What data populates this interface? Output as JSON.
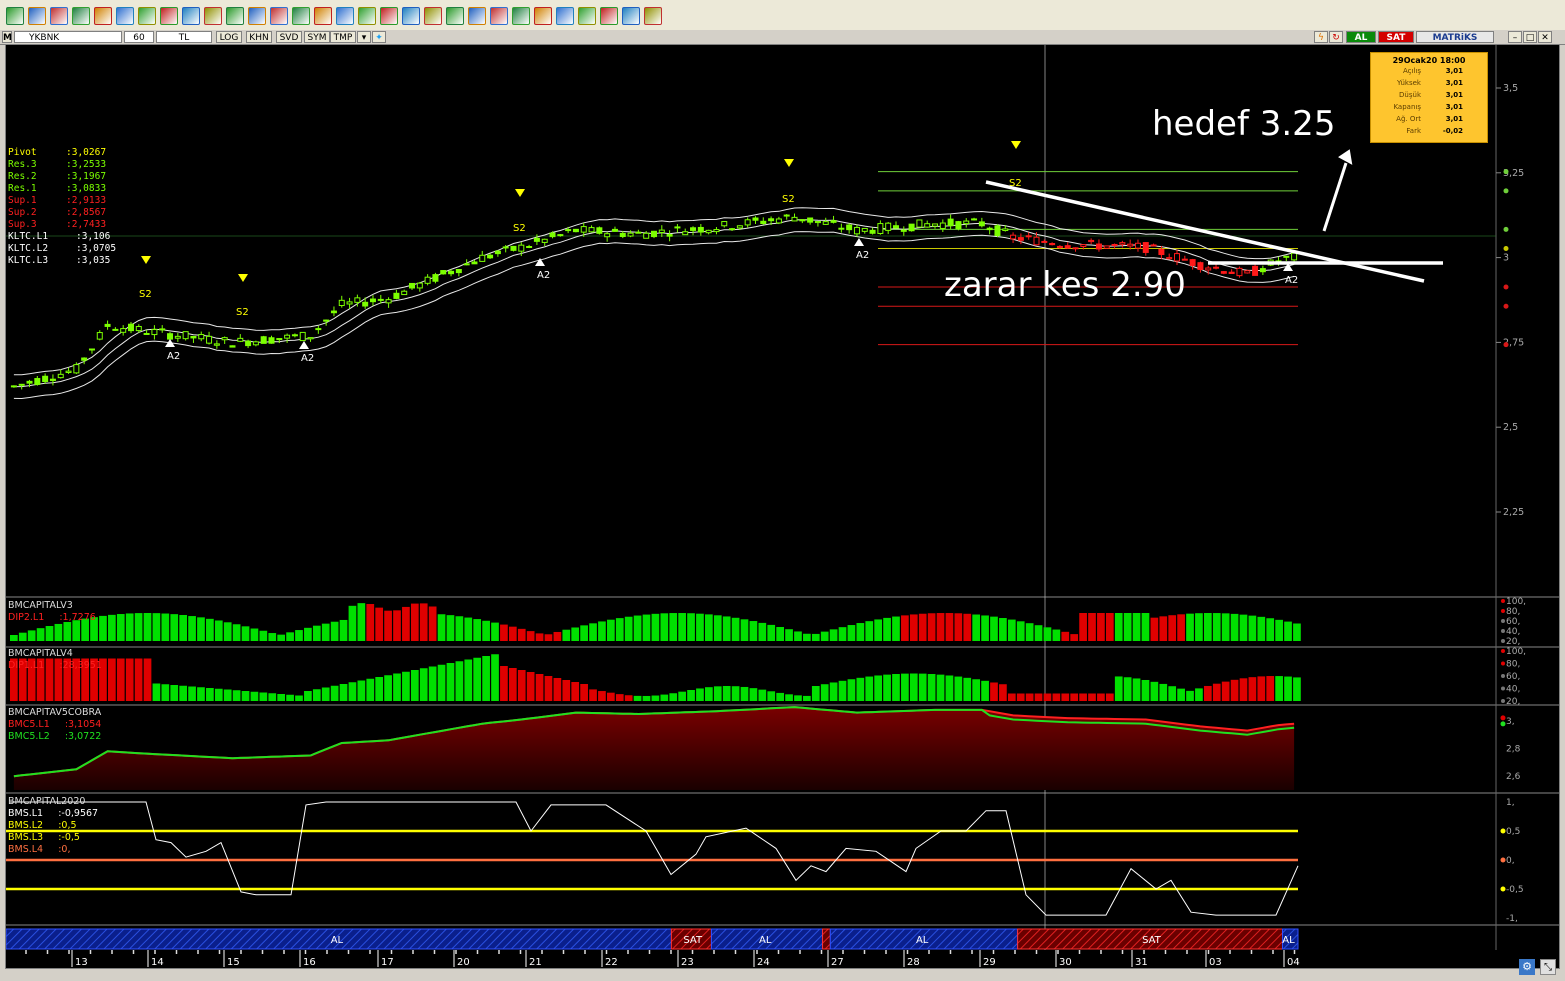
{
  "toolbar": {
    "icons": [
      "lock-icon",
      "cursor-icon",
      "zoom-icon",
      "edit-icon",
      "tools-icon",
      "pencil-icon",
      "eraser-icon",
      "hline-icon",
      "vline-icon",
      "trend-icon",
      "channel-icon",
      "fib-icon",
      "gann-icon",
      "arrow-icon",
      "text-icon",
      "ellipse-icon",
      "rect-icon",
      "cycle-icon",
      "speed-icon",
      "andrew-icon",
      "regression-icon",
      "price-icon",
      "bell-icon",
      "left-icon",
      "right-icon",
      "up-icon",
      "down-icon",
      "alarm-icon",
      "ruler-icon",
      "wave-icon"
    ]
  },
  "symbol_bar": {
    "logo": "M",
    "symbol": "YKBNK",
    "period": "60",
    "currency": "TL",
    "buttons": [
      "LOG",
      "KHN",
      "SVD",
      "SYM",
      "TMP"
    ],
    "al_label": "AL",
    "sat_label": "SAT",
    "brand": "MATRiKS"
  },
  "info_box": {
    "title": "29Ocak20 18:00",
    "rows": [
      {
        "k": "Açılış",
        "v": "3,01"
      },
      {
        "k": "Yüksek",
        "v": "3,01"
      },
      {
        "k": "Düşük",
        "v": "3,01"
      },
      {
        "k": "Kapanış",
        "v": "3,01"
      },
      {
        "k": "Ağ. Ort",
        "v": "3,01"
      },
      {
        "k": "Fark",
        "v": "-0,02"
      }
    ]
  },
  "pivot_legend": [
    {
      "k": "Pivot",
      "v": ":3,0267",
      "color": "#ffff00"
    },
    {
      "k": "Res.3",
      "v": ":3,2533",
      "color": "#7cff00"
    },
    {
      "k": "Res.2",
      "v": ":3,1967",
      "color": "#7cff00"
    },
    {
      "k": "Res.1",
      "v": ":3,0833",
      "color": "#7cff00"
    },
    {
      "k": "Sup.1",
      "v": ":2,9133",
      "color": "#ff2020"
    },
    {
      "k": "Sup.2",
      "v": ":2,8567",
      "color": "#ff2020"
    },
    {
      "k": "Sup.3",
      "v": ":2,7433",
      "color": "#ff2020"
    },
    {
      "k": "KLTC.L1",
      "v": ":3,106",
      "color": "#ffffff"
    },
    {
      "k": "KLTC.L2",
      "v": ":3,0705",
      "color": "#ffffff"
    },
    {
      "k": "KLTC.L3",
      "v": ":3,035",
      "color": "#ffffff"
    }
  ],
  "annotations": {
    "target": "hedef 3.25",
    "stop": "zarar kes 2.90"
  },
  "signals": {
    "s2": "S2",
    "a2": "A2"
  },
  "price_axis": [
    "3,5",
    "3,25",
    "3",
    "2,75",
    "2,5",
    "2,25"
  ],
  "indicators": [
    {
      "title": "BMCAPITALV3",
      "line1": {
        "k": "DIP2.L1",
        "v": ":1,7276"
      },
      "axis": [
        "100,",
        "80,",
        "60,",
        "40,",
        "20,"
      ]
    },
    {
      "title": "BMCAPITALV4",
      "line1": {
        "k": "DIP1.L1",
        "v": ":28,3951"
      },
      "axis": [
        "100,",
        "80,",
        "60,",
        "40,",
        "20,"
      ]
    },
    {
      "title": "BMCAPITAV5COBRA",
      "line1": {
        "k": "BMC5.L1",
        "v": ":3,1054"
      },
      "line2": {
        "k": "BMC5.L2",
        "v": ":3,0722"
      },
      "axis": [
        "3,",
        "2,8",
        "2,6"
      ]
    },
    {
      "title": "BMCAPITAL2020",
      "lines": [
        {
          "k": "BMS.L1",
          "v": ":-0,9567"
        },
        {
          "k": "BMS.L2",
          "v": ":0,5"
        },
        {
          "k": "BMS.L3",
          "v": ":-0,5"
        },
        {
          "k": "BMS.L4",
          "v": ":0,"
        }
      ],
      "axis": [
        "1,",
        "0,5",
        "0,",
        "-0,5",
        "-1,"
      ]
    }
  ],
  "signal_band": [
    {
      "label": "AL",
      "type": "buy",
      "start": 0,
      "end": 0.515
    },
    {
      "label": "SAT",
      "type": "sell",
      "start": 0.515,
      "end": 0.546
    },
    {
      "label": "AL",
      "type": "buy",
      "start": 0.546,
      "end": 0.632
    },
    {
      "label": "",
      "type": "sell",
      "start": 0.632,
      "end": 0.638
    },
    {
      "label": "AL",
      "type": "buy",
      "start": 0.638,
      "end": 0.783
    },
    {
      "label": "SAT",
      "type": "sell",
      "start": 0.783,
      "end": 0.988
    },
    {
      "label": "AL",
      "type": "buy",
      "start": 0.988,
      "end": 1.0
    }
  ],
  "time_axis": [
    "13",
    "14",
    "15",
    "16",
    "17",
    "20",
    "21",
    "22",
    "23",
    "24",
    "27",
    "28",
    "29",
    "30",
    "31",
    "03",
    "04"
  ],
  "colors": {
    "bull": "#7cff00",
    "bear": "#ff1a1a",
    "res": "#6fcf3a",
    "sup": "#d81818",
    "hist_green": "#00e000",
    "hist_red": "#e00000"
  }
}
